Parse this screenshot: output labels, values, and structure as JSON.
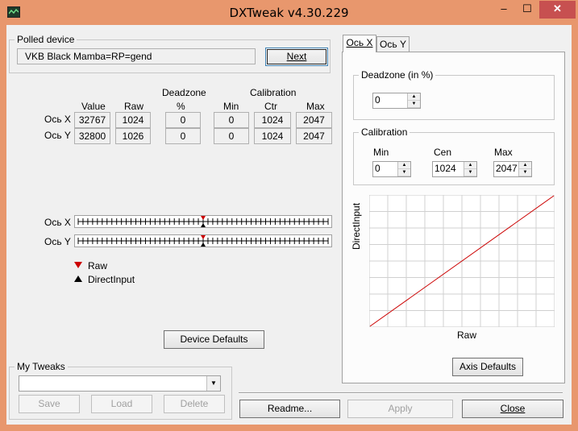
{
  "window": {
    "title": "DXTweak v4.30.229",
    "min": "–",
    "max": "☐",
    "close": "✕"
  },
  "polled": {
    "group_label": "Polled device",
    "device_name": "VKB Black Mamba=RP=gend",
    "next_label": "Next"
  },
  "table": {
    "headers": {
      "deadzone": "Deadzone",
      "calibration": "Calibration",
      "value": "Value",
      "raw": "Raw",
      "pct": "%",
      "min": "Min",
      "ctr": "Ctr",
      "max": "Max"
    },
    "rows": [
      {
        "axis": "Ось X",
        "value": "32767",
        "raw": "1024",
        "deadzone": "0",
        "min": "0",
        "ctr": "1024",
        "max": "2047"
      },
      {
        "axis": "Ось Y",
        "value": "32800",
        "raw": "1026",
        "deadzone": "0",
        "min": "0",
        "ctr": "1024",
        "max": "2047"
      }
    ]
  },
  "sliders": {
    "x_label": "Ось X",
    "y_label": "Ось Y",
    "x_raw_pos": 0.5,
    "x_di_pos": 0.5,
    "y_raw_pos": 0.5,
    "y_di_pos": 0.5
  },
  "legend": {
    "raw": "Raw",
    "directinput": "DirectInput",
    "raw_color": "#cc0000",
    "di_color": "#000000"
  },
  "device_defaults_label": "Device Defaults",
  "tweaks": {
    "group_label": "My Tweaks",
    "selected": "",
    "save": "Save",
    "load": "Load",
    "delete": "Delete"
  },
  "tabs": [
    {
      "label": "Ось X"
    },
    {
      "label": "Ось Y"
    }
  ],
  "axis_panel": {
    "deadzone_label": "Deadzone (in %)",
    "deadzone_value": "0",
    "calibration_label": "Calibration",
    "min_label": "Min",
    "cen_label": "Cen",
    "max_label": "Max",
    "min_value": "0",
    "cen_value": "1024",
    "max_value": "2047",
    "graph_ylabel": "DirectInput",
    "graph_xlabel": "Raw",
    "line_color": "#cc0000",
    "axis_defaults_label": "Axis Defaults"
  },
  "footer": {
    "readme": "Readme...",
    "apply": "Apply",
    "close": "Close"
  }
}
